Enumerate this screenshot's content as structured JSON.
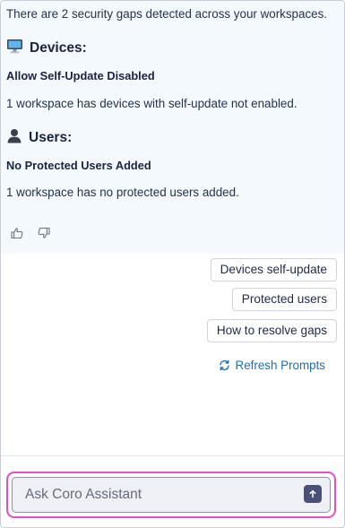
{
  "message": {
    "intro": "There are 2 security gaps detected across your workspaces.",
    "sections": [
      {
        "heading": "Devices:",
        "icon": "computer-icon",
        "gap_title": "Allow Self-Update Disabled",
        "gap_description": "1 workspace has devices with self-update not enabled."
      },
      {
        "heading": "Users:",
        "icon": "user-icon",
        "gap_title": "No Protected Users Added",
        "gap_description": "1 workspace has no protected users added."
      }
    ],
    "feedback": {
      "like_icon": "thumbs-up-icon",
      "dislike_icon": "thumbs-down-icon"
    }
  },
  "prompts": [
    {
      "label": "Devices self-update"
    },
    {
      "label": "Protected users"
    },
    {
      "label": "How to resolve gaps"
    }
  ],
  "refresh": {
    "label": "Refresh Prompts",
    "icon": "refresh-icon"
  },
  "composer": {
    "placeholder": "Ask Coro Assistant",
    "value": "",
    "send_icon": "arrow-up-icon"
  },
  "colors": {
    "accent": "#1f6db5",
    "focus_ring": "#e44fc6",
    "send_button": "#4b5078",
    "message_bg": "#f3f9fd"
  }
}
